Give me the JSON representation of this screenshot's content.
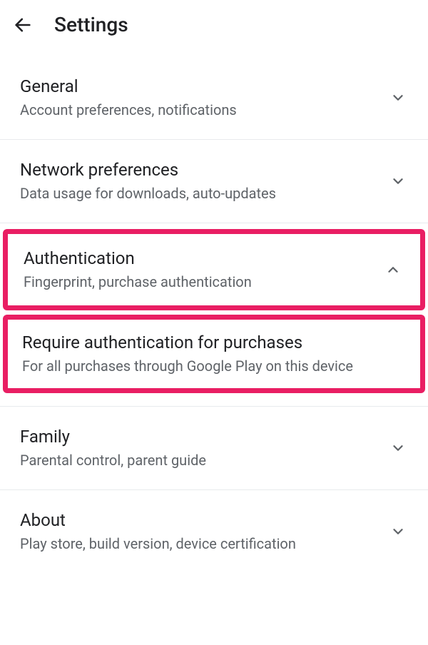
{
  "header": {
    "title": "Settings"
  },
  "items": [
    {
      "title": "General",
      "subtitle": "Account preferences, notifications",
      "expanded": false,
      "highlight": false
    },
    {
      "title": "Network preferences",
      "subtitle": "Data usage for downloads, auto-updates",
      "expanded": false,
      "highlight": false
    },
    {
      "title": "Authentication",
      "subtitle": "Fingerprint, purchase authentication",
      "expanded": true,
      "highlight": true
    },
    {
      "title": "Require authentication for purchases",
      "subtitle": "For all purchases through Google Play on this device",
      "expanded": null,
      "highlight": true
    },
    {
      "title": "Family",
      "subtitle": "Parental control, parent guide",
      "expanded": false,
      "highlight": false
    },
    {
      "title": "About",
      "subtitle": "Play store, build version, device certification",
      "expanded": false,
      "highlight": false
    }
  ]
}
